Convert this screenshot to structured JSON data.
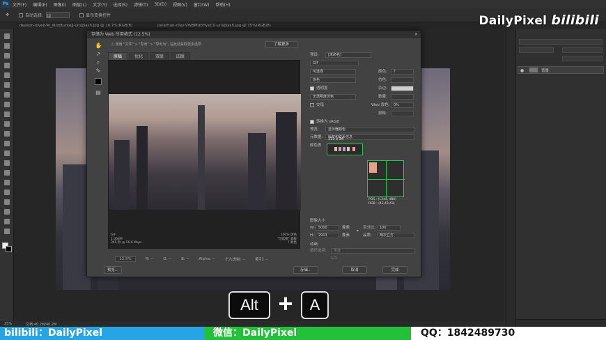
{
  "app": {
    "logo": "Ps"
  },
  "menubar": {
    "items": [
      "文件(F)",
      "编辑(E)",
      "图像(I)",
      "图层(L)",
      "文字(Y)",
      "选择(S)",
      "滤镜(T)",
      "3D(D)",
      "视图(V)",
      "窗口(W)",
      "帮助(H)"
    ]
  },
  "optionbar": {
    "auto_select": "自动选择:",
    "auto_select_value": "组",
    "show_transform": "显示变换控件"
  },
  "brand": {
    "name": "DailyPixel",
    "logo_text": "bilibili"
  },
  "tabs": [
    "deason-lovell-W_lIUzqturkejj-unsplash.jpg @ 16.7%(RGB/8)",
    "jonathan-riley-VW8MUbHyxCU-unsplash.jpg @ 25%(RGB/8)"
  ],
  "statusbar": {
    "zoom": "25%",
    "doc": "文档:40.2M/40.2M"
  },
  "rpanel": {
    "layer_name": "背景"
  },
  "dialog": {
    "title": "存储为 Web 所用格式 (12.5%)",
    "hint": "使用 \"文件\" > \"导出\" > \"导出为\", 在此处获取更多选项",
    "learn_more": "了解更多",
    "view_tabs": [
      "原稿",
      "优化",
      "双联",
      "四联"
    ],
    "preview_info": [
      "GIF",
      "1.308M",
      "365 秒 @ 56.6 Kbps"
    ],
    "preview_info2": [
      "100% 仿色",
      "\"可选择\" 调板",
      "? 颜色"
    ],
    "zoom_value": "12.5%",
    "zoom_labels": [
      "R: --",
      "G: --",
      "B: --",
      "Alpha: --",
      "十六进制: --",
      "索引: --"
    ],
    "preview_button": "预览...",
    "save_button": "存储...",
    "cancel_button": "取消",
    "done_button": "完成",
    "settings": {
      "preset_label": "预设:",
      "preset_value": "[未命名]",
      "format": "GIF",
      "reduction": "可选择",
      "colors_label": "颜色:",
      "colors_value": "?",
      "dither_algo": "杂色",
      "dither_label": "仿色:",
      "transparency_label": "透明度",
      "matte_label": "杂边:",
      "trans_dither": "无透明度仿色",
      "amount_label": "数量:",
      "interlaced_label": "交错",
      "websnap_label": "Web 靠色:",
      "websnap_value": "0%",
      "lossy_label": "损耗:",
      "convert_label": "转换为 sRGB",
      "preview_label": "预览:",
      "preview_value": "显示器颜色",
      "metadata_label": "元数据:",
      "metadata_value": "版权和联系信息",
      "colortable_label": "颜色表",
      "colortable_size": "111 x 34",
      "pos_info": "POS : (1344, 486)",
      "rgb_info": "RGB : (43,43,43)",
      "imagesize_label": "图像大小",
      "w_label": "W:",
      "w_value": "5000",
      "h_label": "H:",
      "h_value": "2913",
      "unit": "像素",
      "percent_label": "百分比:",
      "percent_value": "100",
      "quality_label": "品质:",
      "quality_value": "两次立方",
      "animation_label": "动画",
      "loop_label": "循环选项:",
      "loop_value": "永远",
      "frame_label": "1/1"
    }
  },
  "keys": {
    "key1": "Alt",
    "plus": "+",
    "key2": "A"
  },
  "footer": {
    "bilibili": "bilibili：DailyPixel",
    "wechat": "微信：DailyPixel",
    "qq": "QQ：1842489730"
  },
  "colors": {
    "accent_green": "#22c84a",
    "footer_blue": "#27a4e4",
    "footer_green": "#23c13a"
  }
}
